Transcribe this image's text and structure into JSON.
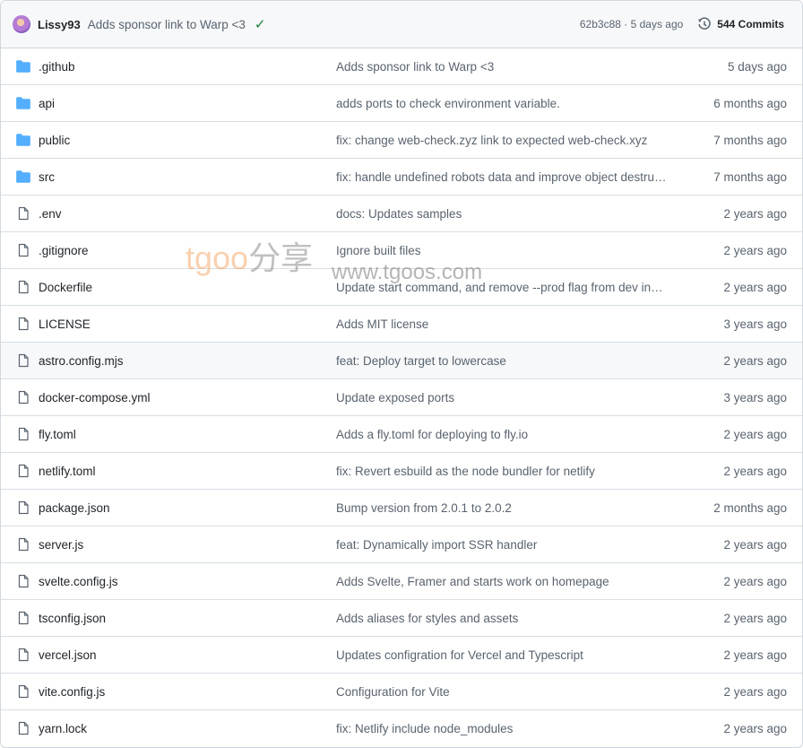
{
  "header": {
    "author": "Lissy93",
    "message": "Adds sponsor link to Warp <3",
    "status_icon": "check-icon",
    "hash_age": "62b3c88 · 5 days ago",
    "commits_label": "544 Commits"
  },
  "files": [
    {
      "type": "folder",
      "name": ".github",
      "message": "Adds sponsor link to Warp <3",
      "age": "5 days ago"
    },
    {
      "type": "folder",
      "name": "api",
      "message": "adds ports to check environment variable.",
      "age": "6 months ago"
    },
    {
      "type": "folder",
      "name": "public",
      "message": "fix: change web-check.zyz link to expected web-check.xyz",
      "age": "7 months ago"
    },
    {
      "type": "folder",
      "name": "src",
      "message": "fix: handle undefined robots data and improve object destru…",
      "age": "7 months ago"
    },
    {
      "type": "file",
      "name": ".env",
      "message": "docs: Updates samples",
      "age": "2 years ago"
    },
    {
      "type": "file",
      "name": ".gitignore",
      "message": "Ignore built files",
      "age": "2 years ago"
    },
    {
      "type": "file",
      "name": "Dockerfile",
      "message": "Update start command, and remove --prod flag from dev in…",
      "age": "2 years ago"
    },
    {
      "type": "file",
      "name": "LICENSE",
      "message": "Adds MIT license",
      "age": "3 years ago"
    },
    {
      "type": "file",
      "name": "astro.config.mjs",
      "message": "feat: Deploy target to lowercase",
      "age": "2 years ago",
      "highlight": true
    },
    {
      "type": "file",
      "name": "docker-compose.yml",
      "message": "Update exposed ports",
      "age": "3 years ago"
    },
    {
      "type": "file",
      "name": "fly.toml",
      "message": "Adds a fly.toml for deploying to fly.io",
      "age": "2 years ago"
    },
    {
      "type": "file",
      "name": "netlify.toml",
      "message": "fix: Revert esbuild as the node bundler for netlify",
      "age": "2 years ago"
    },
    {
      "type": "file",
      "name": "package.json",
      "message": "Bump version from 2.0.1 to 2.0.2",
      "age": "2 months ago"
    },
    {
      "type": "file",
      "name": "server.js",
      "message": "feat: Dynamically import SSR handler",
      "age": "2 years ago"
    },
    {
      "type": "file",
      "name": "svelte.config.js",
      "message": "Adds Svelte, Framer and starts work on homepage",
      "age": "2 years ago"
    },
    {
      "type": "file",
      "name": "tsconfig.json",
      "message": "Adds aliases for styles and assets",
      "age": "2 years ago"
    },
    {
      "type": "file",
      "name": "vercel.json",
      "message": "Updates configration for Vercel and Typescript",
      "age": "2 years ago"
    },
    {
      "type": "file",
      "name": "vite.config.js",
      "message": "Configuration for Vite",
      "age": "2 years ago"
    },
    {
      "type": "file",
      "name": "yarn.lock",
      "message": "fix: Netlify include node_modules",
      "age": "2 years ago"
    }
  ],
  "watermark": {
    "brand_a": "tgoo",
    "brand_b": "分享",
    "url": "www.tgoos.com"
  },
  "colors": {
    "folder": "#54aeff",
    "file": "#59636e",
    "success": "#1a7f37"
  }
}
